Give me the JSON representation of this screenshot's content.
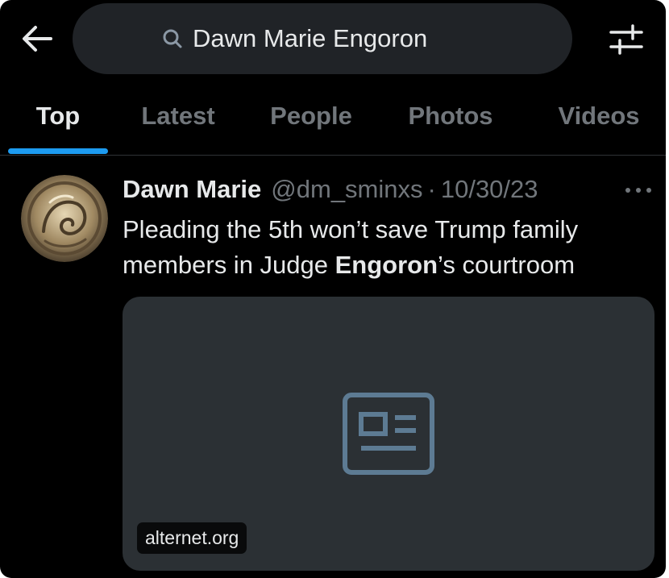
{
  "search": {
    "query": "Dawn Marie Engoron"
  },
  "tabs": [
    {
      "label": "Top",
      "active": true
    },
    {
      "label": "Latest",
      "active": false
    },
    {
      "label": "People",
      "active": false
    },
    {
      "label": "Photos",
      "active": false
    },
    {
      "label": "Videos",
      "active": false
    }
  ],
  "tweet": {
    "display_name": "Dawn Marie",
    "handle": "@dm_sminxs",
    "separator": "·",
    "date": "10/30/23",
    "more": "···",
    "text_part1": "Pleading the 5th won’t save Trump family members in Judge ",
    "text_bold": "Engoron",
    "text_part2": "’s courtroom",
    "card": {
      "domain": "alternet.org"
    }
  },
  "icons": {
    "back": "arrow-left-icon",
    "search": "search-icon",
    "filter": "sliders-icon",
    "more": "more-dots-icon",
    "card_placeholder": "article-icon"
  },
  "colors": {
    "background": "#000000",
    "text_primary": "#e7e9ea",
    "text_secondary": "#71767b",
    "accent": "#1d9bf0",
    "search_bg": "#202327",
    "card_bg": "#2b3034"
  }
}
